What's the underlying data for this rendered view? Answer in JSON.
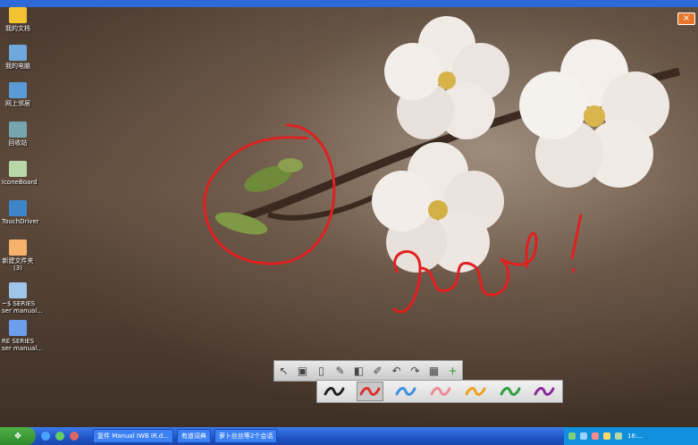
{
  "desktop": {
    "icons": [
      {
        "label": "我的文档",
        "icon": "folder-documents-icon",
        "color": "#f1c232"
      },
      {
        "label": "我的电脑",
        "icon": "computer-icon",
        "color": "#6fa8dc"
      },
      {
        "label": "网上邻居",
        "icon": "network-icon",
        "color": "#5b9bd5"
      },
      {
        "label": "回收站",
        "icon": "recycle-bin-icon",
        "color": "#76a5af"
      },
      {
        "label": "IconeBoard",
        "icon": "iconeboard-icon",
        "color": "#b7d7a8"
      },
      {
        "label": "TouchDriver",
        "icon": "touchdriver-icon",
        "color": "#3d85c6"
      },
      {
        "label": "新建文件夹\n(3)",
        "icon": "folder-icon",
        "color": "#f6b26b"
      },
      {
        "label": "~$ SERIES\nser manual...",
        "icon": "document-icon",
        "color": "#9fc5e8"
      },
      {
        "label": "RE SERIES\nser manual...",
        "icon": "word-document-icon",
        "color": "#6d9eeb"
      }
    ],
    "close_label": "×",
    "handwriting": "good!"
  },
  "toolbar": {
    "tools": [
      {
        "name": "pointer-tool",
        "icon": "arrow-cursor-icon",
        "glyph": "↖"
      },
      {
        "name": "save-tool",
        "icon": "save-icon",
        "glyph": "▣"
      },
      {
        "name": "page-tool",
        "icon": "page-icon",
        "glyph": "▯"
      },
      {
        "name": "pen-tool",
        "icon": "pen-icon",
        "glyph": "✎"
      },
      {
        "name": "eraser-tool",
        "icon": "eraser-icon",
        "glyph": "◧"
      },
      {
        "name": "highlighter-tool",
        "icon": "highlighter-icon",
        "glyph": "✐"
      },
      {
        "name": "undo-tool",
        "icon": "undo-icon",
        "glyph": "↶"
      },
      {
        "name": "redo-tool",
        "icon": "redo-icon",
        "glyph": "↷"
      },
      {
        "name": "screen-tool",
        "icon": "screen-icon",
        "glyph": "▦"
      },
      {
        "name": "add-tool",
        "icon": "plus-icon",
        "glyph": "+"
      }
    ],
    "pen_colors": [
      "#222222",
      "#e03030",
      "#3a8fe0",
      "#f08a96",
      "#f0a020",
      "#2aa040",
      "#8a2a9a"
    ],
    "selected_pen": 1
  },
  "taskbar": {
    "tasks": [
      "复件 Manual IWB IR.d...",
      "有道词典",
      "萝卜丝丝等2个会话"
    ],
    "clock": "16:..."
  }
}
